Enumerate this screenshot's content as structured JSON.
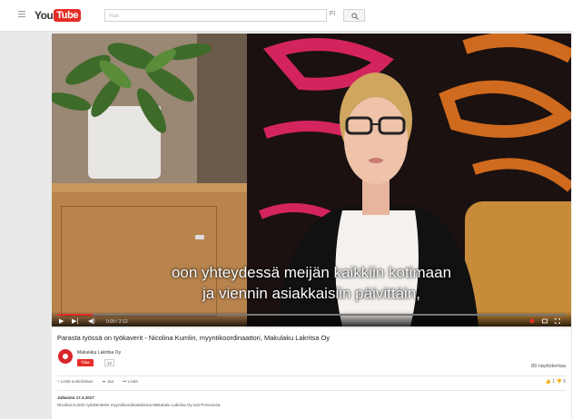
{
  "header": {
    "logo_you": "You",
    "logo_tube": "Tube",
    "search_placeholder": "Hae",
    "search_keyboard": "FI"
  },
  "video": {
    "subtitle_line1": "oon yhteydessä meijän kaikkiin kotimaan",
    "subtitle_line2": "ja viennin asiakkaisiin päivittäin,",
    "time": "0:09 / 2:12",
    "progress": 0.07
  },
  "info": {
    "title": "Parasta työssä on työkaverit - Nicolina Kumlin, myyntikoordinaattori, Makulaku Lakritsa Oy",
    "channel_name": "Makulaku Lakritsa Oy",
    "subscribe_label": "Tilaa",
    "subscriber_count": "12",
    "views": "89 näyttökertaa",
    "action_add": "Lisää soittolistaan",
    "action_share": "Jaa",
    "action_more": "Lisää",
    "likes": "1",
    "dislikes": "0",
    "published": "Julkaistu 17.3.2017",
    "description": "Nicolina Kumlin työskentelee myyntikoordinaattorina Makulaku Lakritsa Oy:ssä Porvoossa."
  },
  "colors": {
    "brand_red": "#e52d27"
  }
}
